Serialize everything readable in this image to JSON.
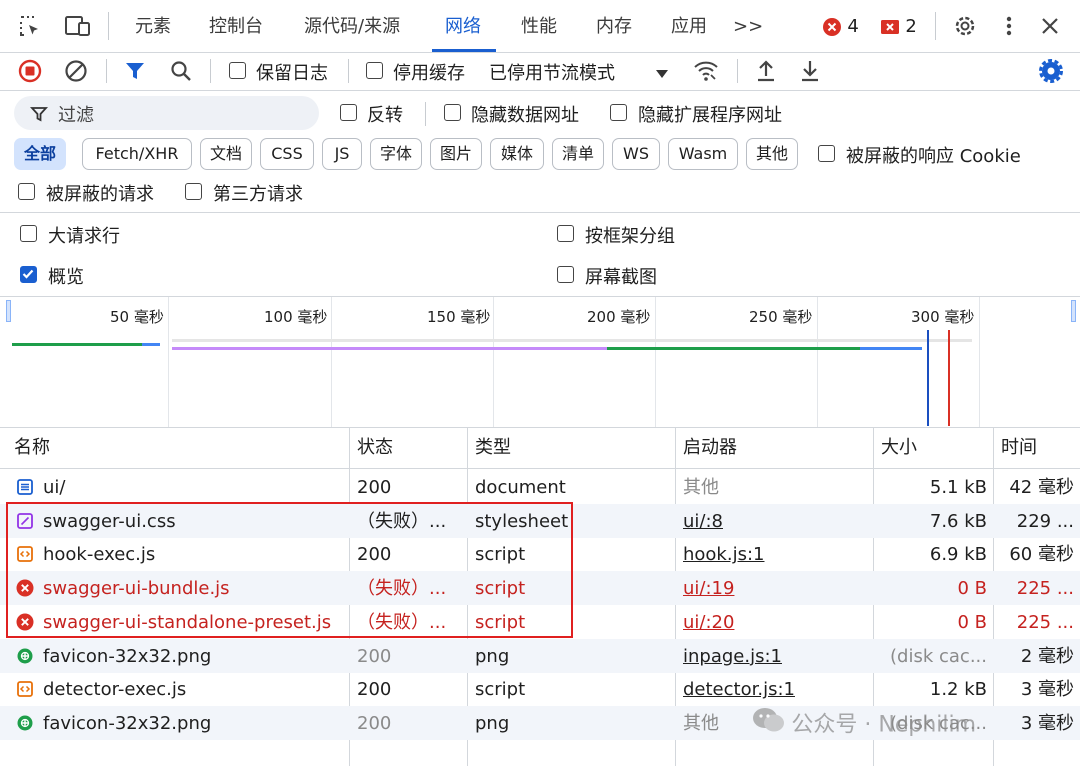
{
  "tabs": [
    "元素",
    "控制台",
    "源代码/来源",
    "网络",
    "性能",
    "内存",
    "应用",
    ">>"
  ],
  "active_tab": "网络",
  "badges": {
    "errors": "4",
    "warnings": "2"
  },
  "toolbar": {
    "preserve_log": "保留日志",
    "disable_cache": "停用缓存",
    "throttle": "已停用节流模式"
  },
  "filter": {
    "placeholder": "过滤",
    "invert": "反转",
    "hide_data_urls": "隐藏数据网址",
    "hide_extension_urls": "隐藏扩展程序网址",
    "types": [
      "全部",
      "Fetch/XHR",
      "文档",
      "CSS",
      "JS",
      "字体",
      "图片",
      "媒体",
      "清单",
      "WS",
      "Wasm",
      "其他"
    ],
    "blocked_response_cookies": "被屏蔽的响应 Cookie",
    "blocked_requests": "被屏蔽的请求",
    "third_party": "第三方请求"
  },
  "settings": {
    "big_rows": "大请求行",
    "group_by_frame": "按框架分组",
    "overview": "概览",
    "screenshots": "屏幕截图"
  },
  "timeline": {
    "ticks": [
      "50 毫秒",
      "100 毫秒",
      "150 毫秒",
      "200 毫秒",
      "250 毫秒",
      "300 毫秒"
    ]
  },
  "table": {
    "headers": [
      "名称",
      "状态",
      "类型",
      "启动器",
      "大小",
      "时间"
    ],
    "rows": [
      {
        "name": "ui/",
        "icon": "document-icon",
        "status": "200",
        "type": "document",
        "initiator": "其他",
        "size": "5.1 kB",
        "time": "42 毫秒",
        "error": false
      },
      {
        "name": "swagger-ui.css",
        "icon": "stylesheet-icon",
        "status": "（失败）...",
        "type": "stylesheet",
        "initiator": "ui/:8",
        "size": "7.6 kB",
        "time": "229 ...",
        "error": false
      },
      {
        "name": "hook-exec.js",
        "icon": "script-icon",
        "status": "200",
        "type": "script",
        "initiator": "hook.js:1",
        "size": "6.9 kB",
        "time": "60 毫秒",
        "error": false
      },
      {
        "name": "swagger-ui-bundle.js",
        "icon": "error-icon",
        "status": "（失败）...",
        "type": "script",
        "initiator": "ui/:19",
        "size": "0 B",
        "time": "225 ...",
        "error": true
      },
      {
        "name": "swagger-ui-standalone-preset.js",
        "icon": "error-icon",
        "status": "（失败）...",
        "type": "script",
        "initiator": "ui/:20",
        "size": "0 B",
        "time": "225 ...",
        "error": true
      },
      {
        "name": "favicon-32x32.png",
        "icon": "image-icon",
        "status": "200",
        "type": "png",
        "initiator": "inpage.js:1",
        "size": "(disk cac...",
        "time": "2 毫秒",
        "error": false
      },
      {
        "name": "detector-exec.js",
        "icon": "script-icon",
        "status": "200",
        "type": "script",
        "initiator": "detector.js:1",
        "size": "1.2 kB",
        "time": "3 毫秒",
        "error": false
      },
      {
        "name": "favicon-32x32.png",
        "icon": "image-icon",
        "status": "200",
        "type": "png",
        "initiator": "其他",
        "size": "(disk cac...",
        "time": "3 毫秒",
        "error": false
      }
    ]
  },
  "watermark": "公众号 · Nephilim",
  "colors": {
    "accent": "#1a5fd0",
    "error": "#c5221f",
    "highlight": "#e02020"
  }
}
